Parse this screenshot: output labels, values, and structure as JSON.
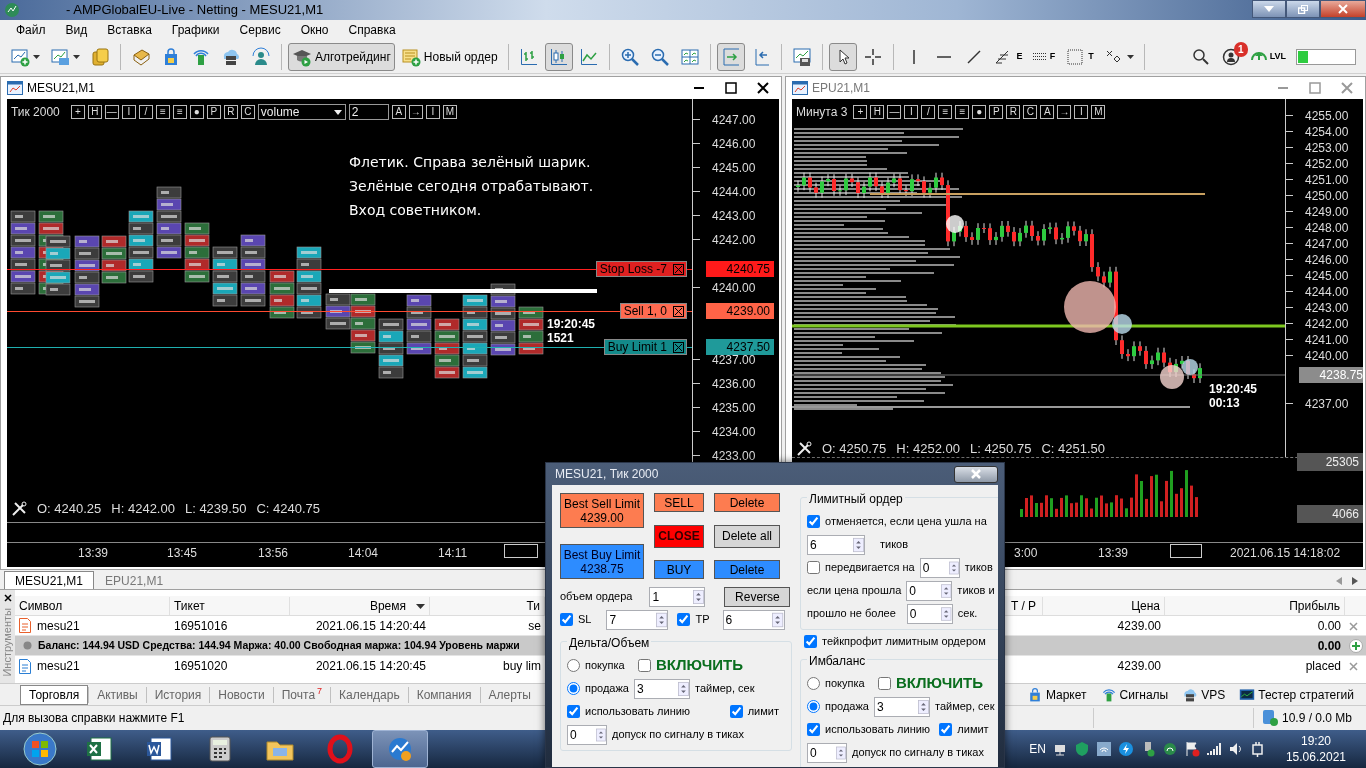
{
  "window": {
    "title": "- AMPGlobalEU-Live - Netting - MESU21,M1"
  },
  "menu": [
    "Файл",
    "Вид",
    "Вставка",
    "Графики",
    "Сервис",
    "Окно",
    "Справка"
  ],
  "toolbar": [
    {
      "kind": "chart-add",
      "selected": false,
      "dropdown": true
    },
    {
      "kind": "template",
      "selected": false,
      "dropdown": true
    },
    {
      "kind": "money",
      "selected": false
    },
    {
      "kind": "separator"
    },
    {
      "kind": "book",
      "selected": false
    },
    {
      "kind": "market",
      "selected": false
    },
    {
      "kind": "signals",
      "selected": false
    },
    {
      "kind": "vps",
      "selected": false
    },
    {
      "kind": "radar",
      "selected": false
    },
    {
      "kind": "separator"
    },
    {
      "kind": "algo",
      "selected": true,
      "label": "Алготрейдинг"
    },
    {
      "kind": "order",
      "selected": false,
      "label": "Новый ордер"
    },
    {
      "kind": "separator"
    },
    {
      "kind": "bars",
      "selected": false
    },
    {
      "kind": "candles",
      "selected": true
    },
    {
      "kind": "line",
      "selected": false
    },
    {
      "kind": "separator"
    },
    {
      "kind": "zoom-in",
      "selected": false
    },
    {
      "kind": "zoom-out",
      "selected": false
    },
    {
      "kind": "tile",
      "selected": false
    },
    {
      "kind": "separator"
    },
    {
      "kind": "autoscroll",
      "selected": true
    },
    {
      "kind": "shift",
      "selected": false
    },
    {
      "kind": "separator"
    },
    {
      "kind": "save",
      "selected": false
    },
    {
      "kind": "separator"
    },
    {
      "kind": "cursor",
      "selected": true
    },
    {
      "kind": "crosshair",
      "selected": false
    },
    {
      "kind": "separator"
    },
    {
      "kind": "vline",
      "selected": false
    },
    {
      "kind": "hline",
      "selected": false
    },
    {
      "kind": "trend",
      "selected": false
    },
    {
      "kind": "fibo-e",
      "selected": false,
      "label": "E"
    },
    {
      "kind": "fibo-f",
      "selected": false,
      "label": "F"
    },
    {
      "kind": "text",
      "selected": false,
      "label": "T"
    },
    {
      "kind": "shapes",
      "selected": false,
      "dropdown": true
    },
    {
      "kind": "separator"
    }
  ],
  "toolbar_right": [
    {
      "kind": "search"
    },
    {
      "kind": "account",
      "badge": "1"
    },
    {
      "kind": "level",
      "label": "LVL"
    },
    {
      "kind": "connection"
    }
  ],
  "charts": [
    {
      "title": "MESU21,M1",
      "active": true,
      "period": "Тик  2000",
      "tools": [
        "+",
        "H",
        "—",
        "I",
        "/",
        "≡",
        "≡",
        "●",
        "P",
        "R",
        "C"
      ],
      "select": "volume",
      "spinner": "2",
      "tools_2": [
        "A",
        "→",
        "I",
        "M"
      ],
      "note": [
        "Флетик. Справа зелёный шарик.",
        "Зелёные сегодня отрабатывают.",
        "Вход советником."
      ],
      "price_axis": [
        "4247.00",
        "4246.00",
        "4245.00",
        "4244.00",
        "4243.00",
        "4242.00",
        "4240.00",
        "4237.00",
        "4236.00",
        "4235.00",
        "4234.00",
        "4233.00"
      ],
      "markers": [
        {
          "text": "4240.75",
          "kind": "stop"
        },
        {
          "text": "4239.00",
          "kind": "sell"
        },
        {
          "text": "4237.50",
          "kind": "buy"
        }
      ],
      "order_lines": [
        {
          "label": "Stop Loss   -7",
          "kind": "stop"
        },
        {
          "label": "Sell  1,  0",
          "kind": "sell"
        },
        {
          "label": "Buy Limit  1",
          "kind": "buy"
        }
      ],
      "last": [
        "19:20:45",
        "1521"
      ],
      "ohlc": [
        "O: 4240.25",
        "H: 4242.00",
        "L: 4239.50",
        "C: 4240.75"
      ],
      "time_axis": [
        "13:39",
        "13:45",
        "13:56",
        "14:04",
        "14:11"
      ]
    },
    {
      "title": "EPU21,M1",
      "active": false,
      "period": "Минута  3",
      "tools": [
        "+",
        "H",
        "—",
        "I",
        "/",
        "≡",
        "≡",
        "●",
        "P",
        "R",
        "C"
      ],
      "tools_2": [
        "A",
        "→",
        "I",
        "M"
      ],
      "price_axis": [
        "4255.00",
        "4254.00",
        "4253.00",
        "4252.00",
        "4251.00",
        "4250.00",
        "4249.00",
        "4248.00",
        "4247.00",
        "4246.00",
        "4245.00",
        "4244.00",
        "4243.00",
        "4242.00",
        "4241.00",
        "4240.00",
        "4237.00"
      ],
      "markers": [
        {
          "text": "4238.75",
          "kind": "last"
        }
      ],
      "last": [
        "19:20:45",
        "00:13"
      ],
      "ohlc": [
        "O: 4250.75",
        "H: 4252.00",
        "L: 4250.75",
        "C: 4251.50"
      ],
      "volume_axis": [
        "25305",
        "4066"
      ],
      "time_axis": [
        "3:00",
        "13:39",
        "2021.06.15 14:18:02"
      ]
    }
  ],
  "dialog": {
    "title": "MESU21, Тик  2000",
    "button_columns": [
      [
        {
          "label": "Best Sell Limit",
          "value": "4239.00",
          "kind": "sell"
        },
        {
          "label": "Best Buy Limit",
          "value": "4238.75",
          "kind": "buy"
        }
      ],
      [
        {
          "label": "SELL",
          "kind": "sell"
        },
        {
          "label": "CLOSE",
          "kind": "close"
        },
        {
          "label": "BUY",
          "kind": "buy"
        }
      ],
      [
        {
          "label": "Delete",
          "kind": "sell"
        },
        {
          "label": "Delete all",
          "kind": "neutral"
        },
        {
          "label": "Delete",
          "kind": "buy"
        }
      ]
    ],
    "volume": {
      "label": "объем ордера",
      "value": "1"
    },
    "reverse": "Reverse",
    "sl": {
      "label": "SL",
      "checked": true,
      "value": "7"
    },
    "tp": {
      "label": "TP",
      "checked": true,
      "value": "6"
    },
    "limit_group": {
      "title": "Лимитный ордер",
      "cancel": {
        "label": "отменяется, если цена ушла на",
        "checked": true,
        "value": "6",
        "unit": "тиков"
      },
      "move": {
        "label": "передвигается на",
        "checked": false,
        "value": "0",
        "unit": "тиков"
      },
      "passed": {
        "label": "если цена прошла",
        "value": "0",
        "unit": "тиков и"
      },
      "within": {
        "label": "прошло не более",
        "value": "0",
        "unit": "сек."
      }
    },
    "take_profit_limit": {
      "label": "тейкпрофит лимитным ордером",
      "checked": true
    },
    "signal_groups": [
      {
        "title": "Дельта/Объем",
        "options": [
          {
            "label": "покупка",
            "selected": false
          },
          {
            "label": "продажа",
            "selected": true
          }
        ],
        "enable": {
          "label": "ВКЛЮЧИТЬ",
          "checked": false
        },
        "timer": {
          "value": "3",
          "label": "таймер, сек"
        },
        "use_line": {
          "label": "использовать линию",
          "checked": true
        },
        "limit": {
          "label": "лимит",
          "checked": true
        },
        "tolerance": {
          "value": "0",
          "label": "допуск по сигналу в тиках"
        }
      },
      {
        "title": "Имбаланс",
        "options": [
          {
            "label": "покупка",
            "selected": false
          },
          {
            "label": "продажа",
            "selected": true
          }
        ],
        "enable": {
          "label": "ВКЛЮЧИТЬ",
          "checked": false
        },
        "timer": {
          "value": "3",
          "label": "таймер, сек"
        },
        "use_line": {
          "label": "использовать линию",
          "checked": true
        },
        "limit": {
          "label": "лимит",
          "checked": true
        },
        "tolerance": {
          "value": "0",
          "label": "допуск по сигналу в тиках"
        }
      }
    ]
  },
  "terminal": {
    "chart_tabs": [
      {
        "label": "MESU21,M1",
        "selected": true
      },
      {
        "label": "EPU21,M1",
        "selected": false
      }
    ],
    "side_label": "Инструменты",
    "columns": [
      {
        "label": "Символ",
        "sorted": false
      },
      {
        "label": "Тикет",
        "sorted": false
      },
      {
        "label": "Время",
        "sorted": true
      },
      {
        "label": "Ти",
        "sorted": false
      },
      {
        "label": "T / P",
        "sorted": false
      },
      {
        "label": "Цена",
        "sorted": false
      },
      {
        "label": "Прибыль",
        "sorted": false
      }
    ],
    "rows": [
      {
        "kind": "sell",
        "symbol": "mesu21",
        "ticket": "16951016",
        "time": "2021.06.15 14:20:44",
        "type": "se",
        "price": "4239.00",
        "profit": "0.00"
      },
      {
        "kind": "balance",
        "text": "Баланс: 144.94 USD  Средства: 144.94  Маржа: 40.00  Свободная маржа: 104.94  Уровень маржи",
        "profit": "0.00"
      },
      {
        "kind": "buy",
        "symbol": "mesu21",
        "ticket": "16951020",
        "time": "2021.06.15 14:20:45",
        "type": "buy lim",
        "price": "4239.00",
        "profit": "placed"
      }
    ],
    "tabs": [
      {
        "label": "Торговля",
        "selected": true
      },
      {
        "label": "Активы",
        "selected": false
      },
      {
        "label": "История",
        "selected": false
      },
      {
        "label": "Новости",
        "selected": false
      },
      {
        "label": "Почта",
        "selected": false,
        "badge": "7"
      },
      {
        "label": "Календарь",
        "selected": false
      },
      {
        "label": "Компания",
        "selected": false
      },
      {
        "label": "Алерты",
        "selected": false
      }
    ],
    "services": [
      {
        "kind": "market",
        "label": "Маркет"
      },
      {
        "kind": "signals",
        "label": "Сигналы"
      },
      {
        "kind": "vps",
        "label": "VPS"
      },
      {
        "kind": "tester",
        "label": "Тестер стратегий"
      }
    ]
  },
  "status_bar": {
    "text": "Для вызова справки нажмите F1",
    "traffic": "10.9 / 0.0 Mb"
  },
  "taskbar": {
    "apps": [
      {
        "kind": "excel",
        "active": false
      },
      {
        "kind": "word",
        "active": false
      },
      {
        "kind": "calculator",
        "active": false
      },
      {
        "kind": "explorer",
        "active": false
      },
      {
        "kind": "opera",
        "active": false
      },
      {
        "kind": "metatrader",
        "active": true
      }
    ],
    "language": "EN",
    "time": "19:20",
    "date": "15.06.2021"
  }
}
